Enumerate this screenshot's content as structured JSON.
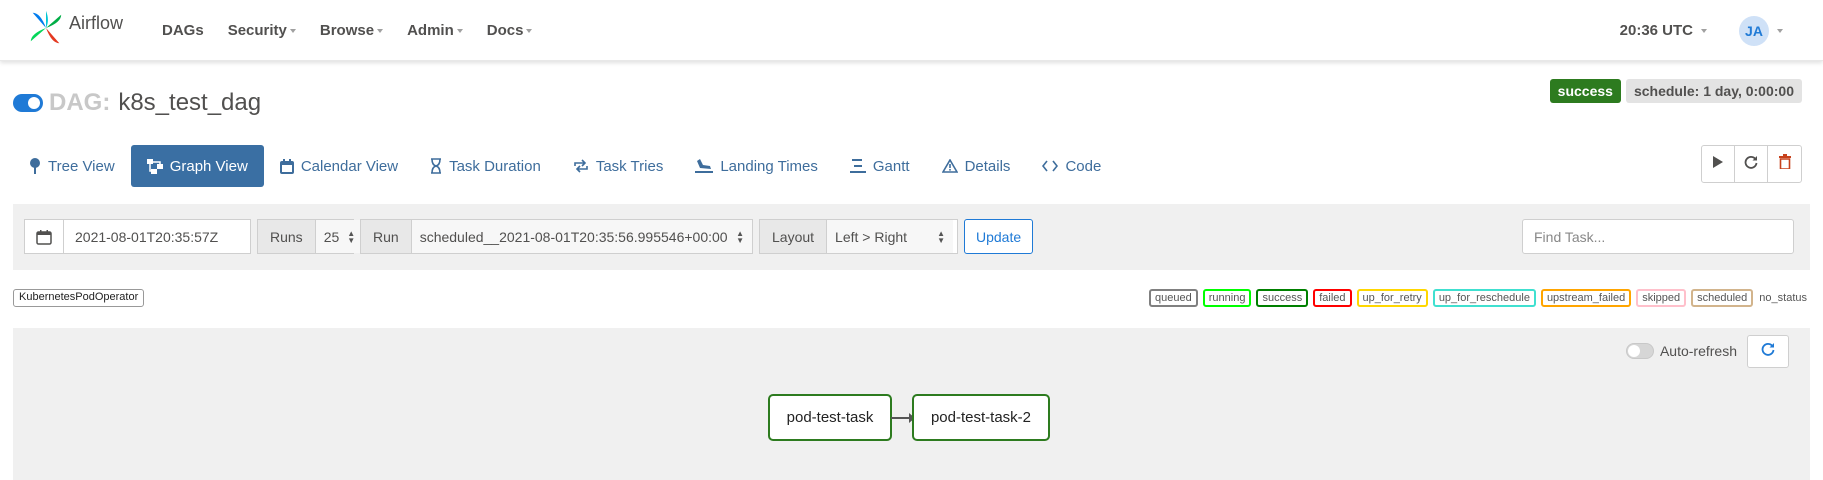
{
  "brand": {
    "name": "Airflow"
  },
  "nav": {
    "items": [
      {
        "label": "DAGs",
        "dropdown": false
      },
      {
        "label": "Security",
        "dropdown": true
      },
      {
        "label": "Browse",
        "dropdown": true
      },
      {
        "label": "Admin",
        "dropdown": true
      },
      {
        "label": "Docs",
        "dropdown": true
      }
    ],
    "clock": "20:36 UTC",
    "user_initials": "JA"
  },
  "dag": {
    "label": "DAG:",
    "id": "k8s_test_dag",
    "paused": false,
    "status": "success",
    "schedule": "schedule: 1 day, 0:00:00"
  },
  "tabs": [
    {
      "label": "Tree View",
      "icon": "tree-icon",
      "active": false
    },
    {
      "label": "Graph View",
      "icon": "graph-icon",
      "active": true
    },
    {
      "label": "Calendar View",
      "icon": "calendar-icon",
      "active": false
    },
    {
      "label": "Task Duration",
      "icon": "hourglass-icon",
      "active": false
    },
    {
      "label": "Task Tries",
      "icon": "repeat-icon",
      "active": false
    },
    {
      "label": "Landing Times",
      "icon": "landing-icon",
      "active": false
    },
    {
      "label": "Gantt",
      "icon": "gantt-icon",
      "active": false
    },
    {
      "label": "Details",
      "icon": "warning-icon",
      "active": false
    },
    {
      "label": "Code",
      "icon": "code-icon",
      "active": false
    }
  ],
  "actions": [
    "play-icon",
    "refresh-icon",
    "trash-icon"
  ],
  "filters": {
    "date": "2021-08-01T20:35:57Z",
    "runs_label": "Runs",
    "runs_value": "25",
    "run_label": "Run",
    "run_value": "scheduled__2021-08-01T20:35:56.995546+00:00",
    "layout_label": "Layout",
    "layout_value": "Left > Right",
    "update": "Update",
    "find_placeholder": "Find Task..."
  },
  "operator": "KubernetesPodOperator",
  "legend": [
    {
      "label": "queued",
      "color": "#808080"
    },
    {
      "label": "running",
      "color": "#00ff00"
    },
    {
      "label": "success",
      "color": "#008000"
    },
    {
      "label": "failed",
      "color": "#ff0000"
    },
    {
      "label": "up_for_retry",
      "color": "#ffd700"
    },
    {
      "label": "up_for_reschedule",
      "color": "#40e0d0"
    },
    {
      "label": "upstream_failed",
      "color": "#ffa500"
    },
    {
      "label": "skipped",
      "color": "#ffc0cb"
    },
    {
      "label": "scheduled",
      "color": "#d2b48c"
    }
  ],
  "no_status": "no_status",
  "graph": {
    "auto_refresh": "Auto-refresh",
    "nodes": [
      "pod-test-task",
      "pod-test-task-2"
    ]
  }
}
